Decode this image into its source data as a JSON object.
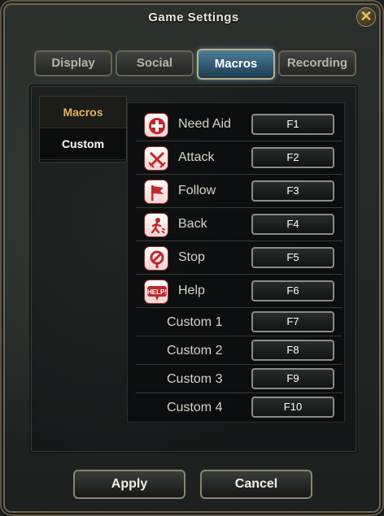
{
  "window": {
    "title": "Game Settings",
    "close_icon": "✕"
  },
  "tabs": [
    {
      "label": "Display",
      "active": false
    },
    {
      "label": "Social",
      "active": false
    },
    {
      "label": "Macros",
      "active": true
    },
    {
      "label": "Recording",
      "active": false
    }
  ],
  "subnav": [
    {
      "label": "Macros",
      "active": true
    },
    {
      "label": "Custom",
      "active": false
    }
  ],
  "macros": [
    {
      "label": "Need Aid",
      "key": "F1",
      "icon": "medic-cross-icon"
    },
    {
      "label": "Attack",
      "key": "F2",
      "icon": "crossed-swords-icon"
    },
    {
      "label": "Follow",
      "key": "F3",
      "icon": "flag-icon"
    },
    {
      "label": "Back",
      "key": "F4",
      "icon": "retreat-figure-icon"
    },
    {
      "label": "Stop",
      "key": "F5",
      "icon": "stop-sign-icon"
    },
    {
      "label": "Help",
      "key": "F6",
      "icon": "help-bubble-icon"
    }
  ],
  "custom_macros": [
    {
      "label": "Custom 1",
      "key": "F7"
    },
    {
      "label": "Custom 2",
      "key": "F8"
    },
    {
      "label": "Custom 3",
      "key": "F9"
    },
    {
      "label": "Custom 4",
      "key": "F10"
    }
  ],
  "footer": {
    "apply_label": "Apply",
    "cancel_label": "Cancel"
  },
  "colors": {
    "active_tab": "#2f5a72",
    "active_subnav": "#e8b45a",
    "icon_red": "#c0282a"
  }
}
